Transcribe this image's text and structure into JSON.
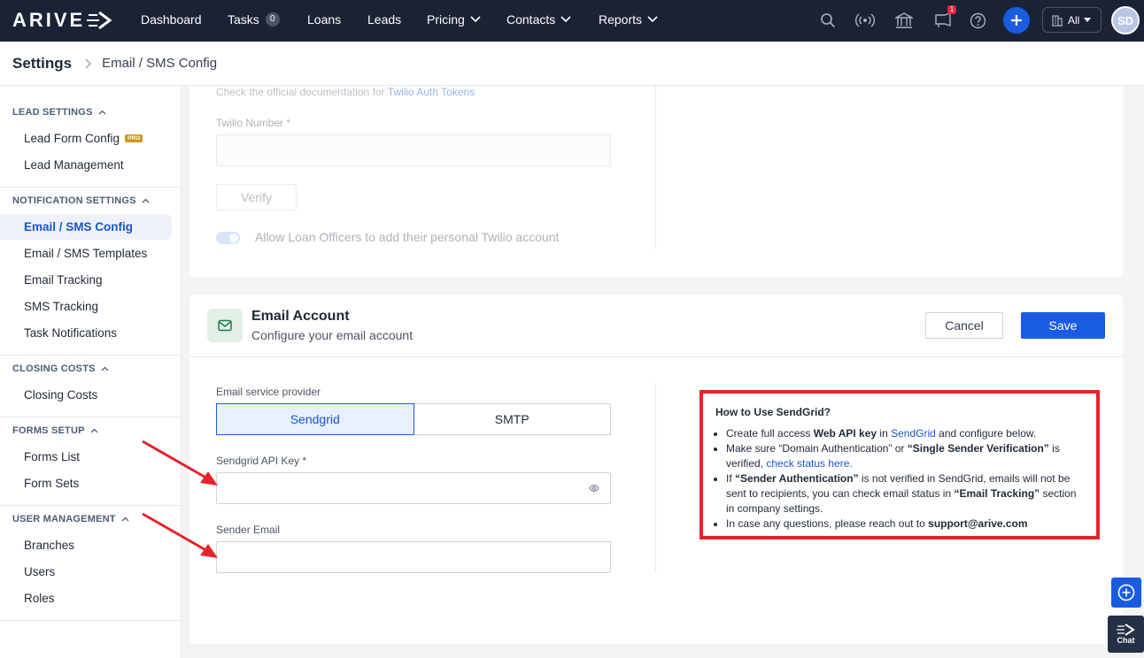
{
  "brand": {
    "logo_text": "ARIVE"
  },
  "nav": {
    "items": [
      {
        "label": "Dashboard"
      },
      {
        "label": "Tasks",
        "badge": "0"
      },
      {
        "label": "Loans"
      },
      {
        "label": "Leads"
      },
      {
        "label": "Pricing"
      },
      {
        "label": "Contacts"
      },
      {
        "label": "Reports"
      }
    ],
    "notifications_count": "1",
    "scope_select": "All",
    "avatar_initials": "SD"
  },
  "header": {
    "title": "Settings",
    "breadcrumb": "Email / SMS Config"
  },
  "sidebar": {
    "sections": [
      {
        "title": "LEAD SETTINGS",
        "items": [
          "Lead Form Config",
          "Lead Management"
        ]
      },
      {
        "title": "NOTIFICATION SETTINGS",
        "items": [
          "Email / SMS Config",
          "Email / SMS Templates",
          "Email Tracking",
          "SMS Tracking",
          "Task Notifications"
        ]
      },
      {
        "title": "CLOSING COSTS",
        "items": [
          "Closing Costs"
        ]
      },
      {
        "title": "FORMS SETUP",
        "items": [
          "Forms List",
          "Form Sets"
        ]
      },
      {
        "title": "USER MANAGEMENT",
        "items": [
          "Branches",
          "Users",
          "Roles"
        ]
      }
    ],
    "pro_badge": "PRO",
    "active_item": "Email / SMS Config"
  },
  "twilio": {
    "doc_text": "Check the official documentation for",
    "doc_link": "Twilio Auth Tokens",
    "number_label": "Twilio Number *",
    "number_value": "",
    "verify_label": "Verify",
    "toggle_label": "Allow Loan Officers to add their personal Twilio account",
    "toggle_on": true
  },
  "email_account": {
    "title": "Email Account",
    "subtitle": "Configure your email account",
    "cancel_label": "Cancel",
    "save_label": "Save",
    "provider_label": "Email service provider",
    "providers": [
      "Sendgrid",
      "SMTP"
    ],
    "selected_provider": "Sendgrid",
    "api_key_label": "Sendgrid API Key *",
    "api_key_value": "",
    "sender_label": "Sender Email",
    "sender_value": ""
  },
  "howto": {
    "title": "How to Use SendGrid?",
    "b1_pre": "Create full access ",
    "b1_bold": "Web API key",
    "b1_mid": " in ",
    "b1_link": "SendGrid",
    "b1_post": " and configure below.",
    "b2_pre": "Make sure “Domain Authentication” or ",
    "b2_bold": "“Single Sender Verification”",
    "b2_mid": " is verified, ",
    "b2_link": "check status here.",
    "b3_pre": "If ",
    "b3_bold": "“Sender Authentication”",
    "b3_mid": " is not verified in SendGrid, emails will not be sent to recipients, you can check email status in ",
    "b3_bold2": "“Email Tracking”",
    "b3_post": " section in company settings.",
    "b4_pre": "In case any questions, please reach out to ",
    "b4_bold": "support@arive.com"
  },
  "floating": {
    "chat_label": "Chat"
  },
  "colors": {
    "nav_bg": "#1a2235",
    "primary": "#1a5ce0",
    "highlight_border": "#e6232b",
    "arrow": "#e6232b"
  }
}
